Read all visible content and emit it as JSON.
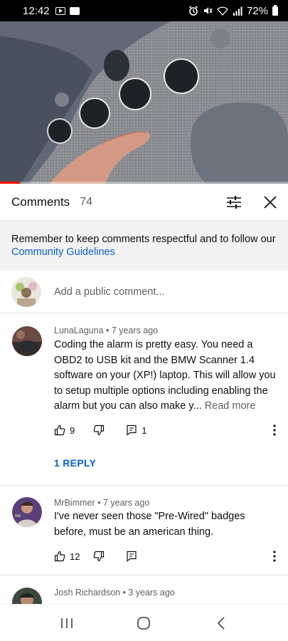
{
  "status_bar": {
    "time": "12:42",
    "battery": "72%",
    "icons": [
      "youtube-notification-icon",
      "image-notification-icon",
      "alarm-icon",
      "mute-icon",
      "wifi-icon",
      "signal-icon",
      "battery-icon"
    ]
  },
  "video": {
    "progress_fraction": 0.07,
    "progress_color": "#ff0000"
  },
  "comments_header": {
    "title": "Comments",
    "count": "74"
  },
  "guidelines": {
    "text": "Remember to keep comments respectful and to follow our ",
    "link": "Community Guidelines"
  },
  "add_comment": {
    "placeholder": "Add a public comment..."
  },
  "comments": [
    {
      "meta": "LunaLaguna • 7 years ago",
      "text": "Coding the alarm is pretty easy. You need a OBD2 to USB kit and the BMW Scanner 1.4 software on your (XP!) laptop. This will allow you to setup multiple options including enabling the alarm but you can also make y... ",
      "read_more": "Read more",
      "likes": "9",
      "replies_count": "1",
      "reply_link": "1 REPLY"
    },
    {
      "meta": "MrBimmer • 7 years ago",
      "text": "I've never seen those \"Pre-Wired\" badges before, must be an american thing.",
      "likes": "12"
    },
    {
      "meta": "Josh Richardson • 3 years ago"
    }
  ],
  "colors": {
    "link_blue": "#065fd4",
    "secondary_text": "#606060",
    "guideline_bg": "#f2f2f2"
  }
}
